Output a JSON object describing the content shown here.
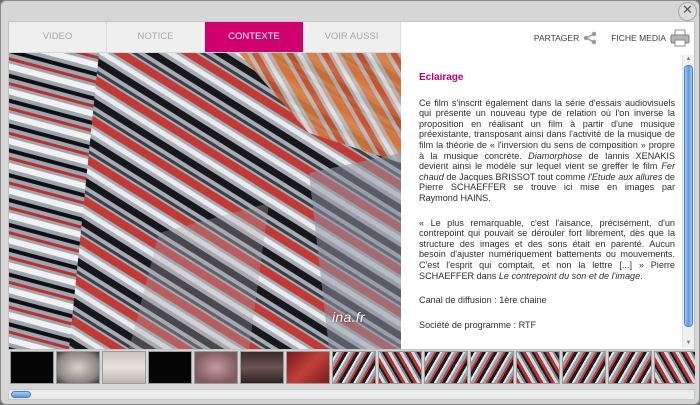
{
  "window": {
    "close_glyph": "✕"
  },
  "tabs": [
    {
      "label": "VIDEO",
      "active": false
    },
    {
      "label": "NOTICE",
      "active": false
    },
    {
      "label": "CONTEXTE",
      "active": true
    },
    {
      "label": "VOIR AUSSI",
      "active": false
    }
  ],
  "actions": {
    "share_label": "PARTAGER",
    "share_icon": "share-icon",
    "media_label": "FICHE MEDIA",
    "media_icon": "print-icon"
  },
  "video": {
    "logo": "ina.fr"
  },
  "article": {
    "title": "Éclairage",
    "p1": [
      {
        "t": "Ce film s'inscrit également dans la série d'essais audiovisuels qui présente un nouveau type de relation où l'on inverse la proposition en réalisant un film à partir d'une musique préexistante, transposant ainsi dans l'activité de la musique de film la théorie de « l'inversion du sens de composition » propre à la musique concrète. "
      },
      {
        "t": "Diamorphose",
        "i": true
      },
      {
        "t": " de Iannis XENAKIS devient ainsi le modèle sur lequel vient se greffer le film "
      },
      {
        "t": "Fer chaud",
        "i": true
      },
      {
        "t": " de Jacques BRISSOT tout comme "
      },
      {
        "t": "l'Etude aux allures",
        "i": true
      },
      {
        "t": " de Pierre SCHAEFFER se trouve ici mise en images par Raymond HAINS."
      }
    ],
    "p2": [
      {
        "t": "« Le plus remarquable, c'est l'aisance, précisément, d'un contrepoint qui pouvait se dérouler fort librement, dès que la structure des images et des sons était en parenté. Aucun besoin d'ajuster numériquement battements ou mouvements. C'est l'esprit qui comptait, et non la lettre [...] » Pierre SCHAEFFER dans "
      },
      {
        "t": "Le contrepoint du son et de l'image",
        "i": true
      },
      {
        "t": "."
      }
    ],
    "canal": "Canal de diffusion : 1ère chaine",
    "societe": "Société de programme : RTF"
  },
  "thumbnails": [
    {
      "kind": "black"
    },
    {
      "kind": "title"
    },
    {
      "kind": "paper"
    },
    {
      "kind": "black"
    },
    {
      "kind": "title-pink"
    },
    {
      "kind": "dark"
    },
    {
      "kind": "red"
    },
    {
      "kind": "pattern"
    },
    {
      "kind": "pattern-red"
    },
    {
      "kind": "pattern"
    },
    {
      "kind": "pattern"
    },
    {
      "kind": "pattern-red"
    },
    {
      "kind": "pattern"
    },
    {
      "kind": "pattern"
    },
    {
      "kind": "pattern-red"
    }
  ]
}
